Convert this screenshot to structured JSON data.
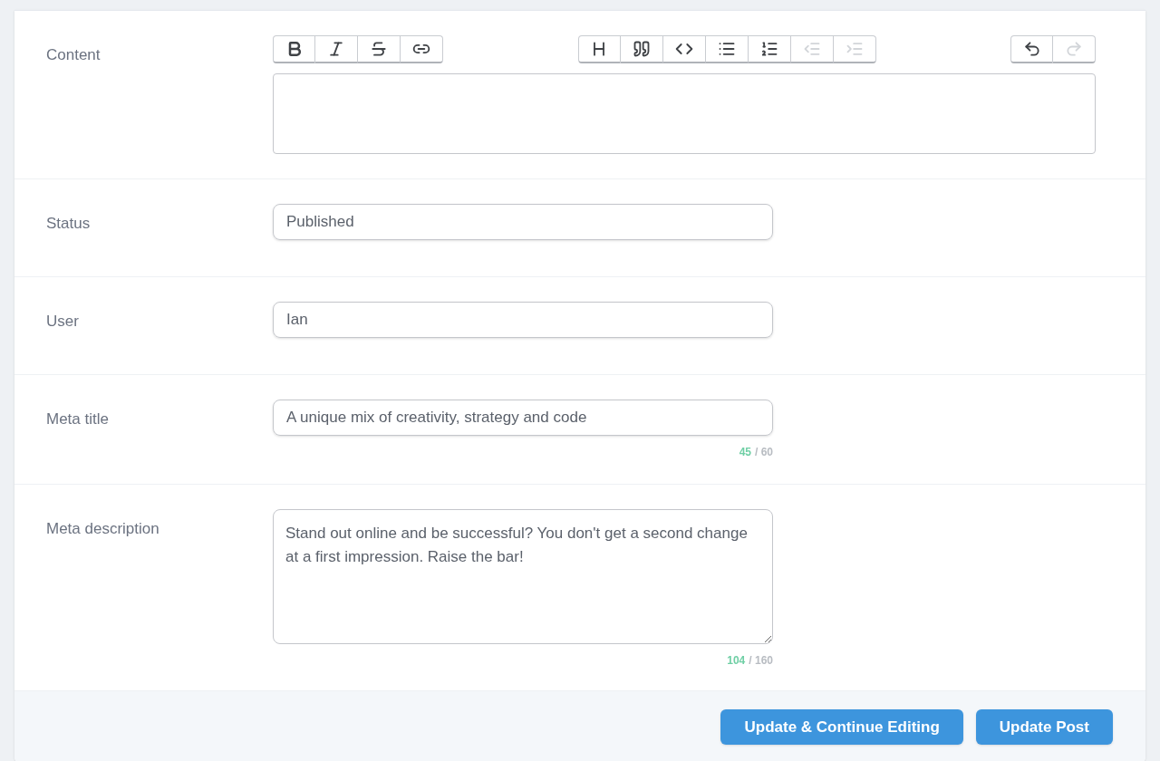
{
  "content": {
    "label": "Content",
    "toolbar_groups": [
      {
        "buttons": [
          {
            "kind": "bold",
            "disabled": false
          },
          {
            "kind": "italic",
            "disabled": false
          },
          {
            "kind": "strike",
            "disabled": false
          },
          {
            "kind": "link",
            "disabled": false
          }
        ]
      },
      {
        "buttons": [
          {
            "kind": "heading",
            "disabled": false
          },
          {
            "kind": "quote",
            "disabled": false
          },
          {
            "kind": "code",
            "disabled": false
          },
          {
            "kind": "bullets",
            "disabled": false
          },
          {
            "kind": "numbers",
            "disabled": false
          },
          {
            "kind": "outdent",
            "disabled": true
          },
          {
            "kind": "indent",
            "disabled": true
          }
        ]
      },
      {
        "buttons": [
          {
            "kind": "undo",
            "disabled": false
          },
          {
            "kind": "redo",
            "disabled": true
          }
        ]
      }
    ]
  },
  "fields": [
    {
      "kind": "input",
      "label": "Status",
      "value": "Published"
    },
    {
      "kind": "input",
      "label": "User",
      "value": "Ian"
    },
    {
      "kind": "input",
      "label": "Meta title",
      "value": "A unique mix of creativity, strategy and code",
      "count": "45",
      "limit": "/ 60"
    },
    {
      "kind": "textarea",
      "label": "Meta description",
      "value": "Stand out online and be successful? You don't get a second change at a first impression. Raise the bar!",
      "count": "104",
      "limit": "/ 160"
    }
  ],
  "buttons": [
    "Update & Continue Editing",
    "Update Post"
  ]
}
